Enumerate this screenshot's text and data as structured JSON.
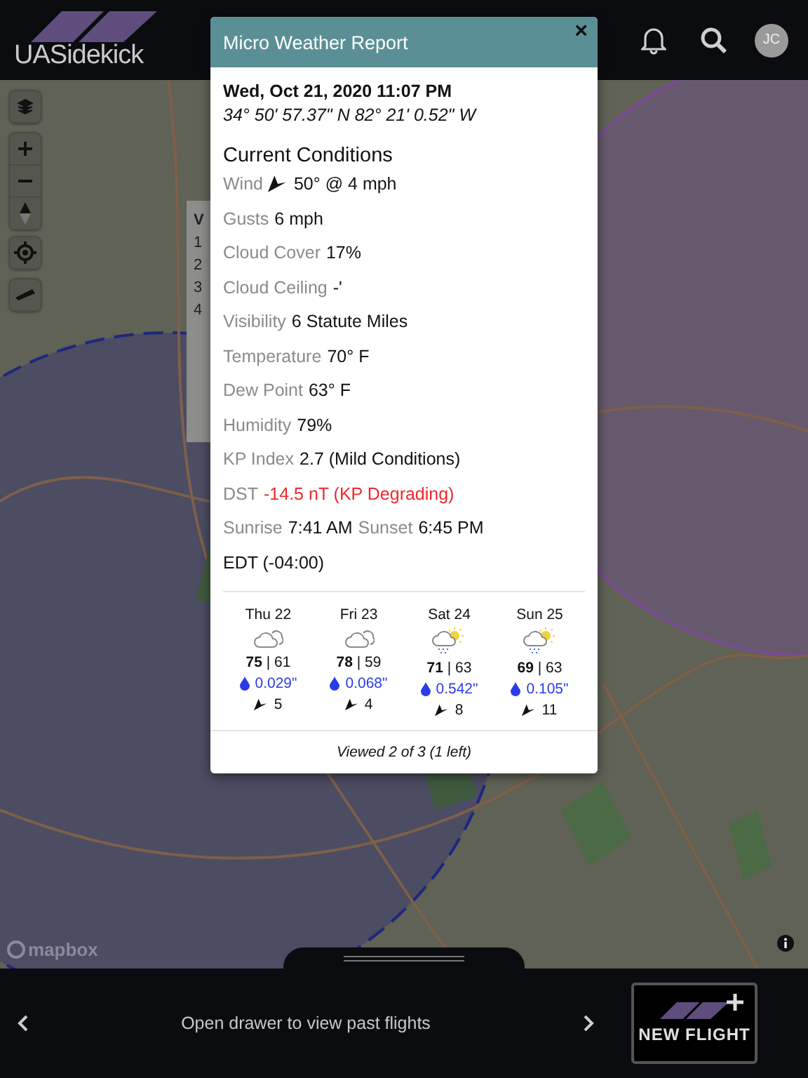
{
  "app": {
    "logo": "UASidekick",
    "avatar": "JC"
  },
  "map": {
    "kind": "picture",
    "attribution": "mapbox"
  },
  "side_panel": {
    "title": "V",
    "items": [
      "1",
      "2",
      "3",
      "4"
    ]
  },
  "modal": {
    "title": "Micro Weather Report",
    "close": "×",
    "datetime": "Wed, Oct 21, 2020 11:07 PM",
    "coordinates": "34° 50' 57.37\" N 82° 21' 0.52\" W",
    "section": "Current Conditions",
    "rows": [
      {
        "kind": "wind",
        "label": "Wind",
        "value": "50° @ 4 mph"
      },
      {
        "kind": "plain",
        "label": "Gusts",
        "value": "6 mph"
      },
      {
        "kind": "plain",
        "label": "Cloud Cover",
        "value": "17%"
      },
      {
        "kind": "plain",
        "label": "Cloud Ceiling",
        "value": "-'"
      },
      {
        "kind": "plain",
        "label": "Visibility",
        "value": "6 Statute Miles"
      },
      {
        "kind": "plain",
        "label": "Temperature",
        "value": "70° F"
      },
      {
        "kind": "plain",
        "label": "Dew Point",
        "value": "63° F"
      },
      {
        "kind": "plain",
        "label": "Humidity",
        "value": "79%"
      },
      {
        "kind": "plain",
        "label": "KP Index",
        "value": "2.7 (Mild Conditions)"
      },
      {
        "kind": "plain",
        "label": "DST",
        "value": "-14.5 nT (KP Degrading)",
        "alert": true
      },
      {
        "kind": "pair",
        "label": "Sunrise",
        "value": "7:41 AM",
        "label2": "Sunset",
        "value2": "6:45 PM"
      }
    ],
    "timezone": "EDT (-04:00)",
    "forecast": [
      {
        "day": "Thu 22",
        "kind": "cloudy",
        "temps": "**75** | 61",
        "precip": "0.029\"",
        "wind": "5"
      },
      {
        "day": "Fri 23",
        "kind": "cloudy",
        "temps": "**78** | 59",
        "precip": "0.068\"",
        "wind": "4"
      },
      {
        "day": "Sat 24",
        "kind": "showers-sun",
        "temps": "**71** | 63",
        "precip": "0.542\"",
        "wind": "8"
      },
      {
        "day": "Sun 25",
        "kind": "showers-sun",
        "temps": "**69** | 63",
        "precip": "0.105\"",
        "wind": "11"
      }
    ],
    "footer": "Viewed 2 of 3 (1 left)"
  },
  "bottom_bar": {
    "drawer_text": "Open drawer to view past flights",
    "new_flight": "NEW FLIGHT"
  }
}
